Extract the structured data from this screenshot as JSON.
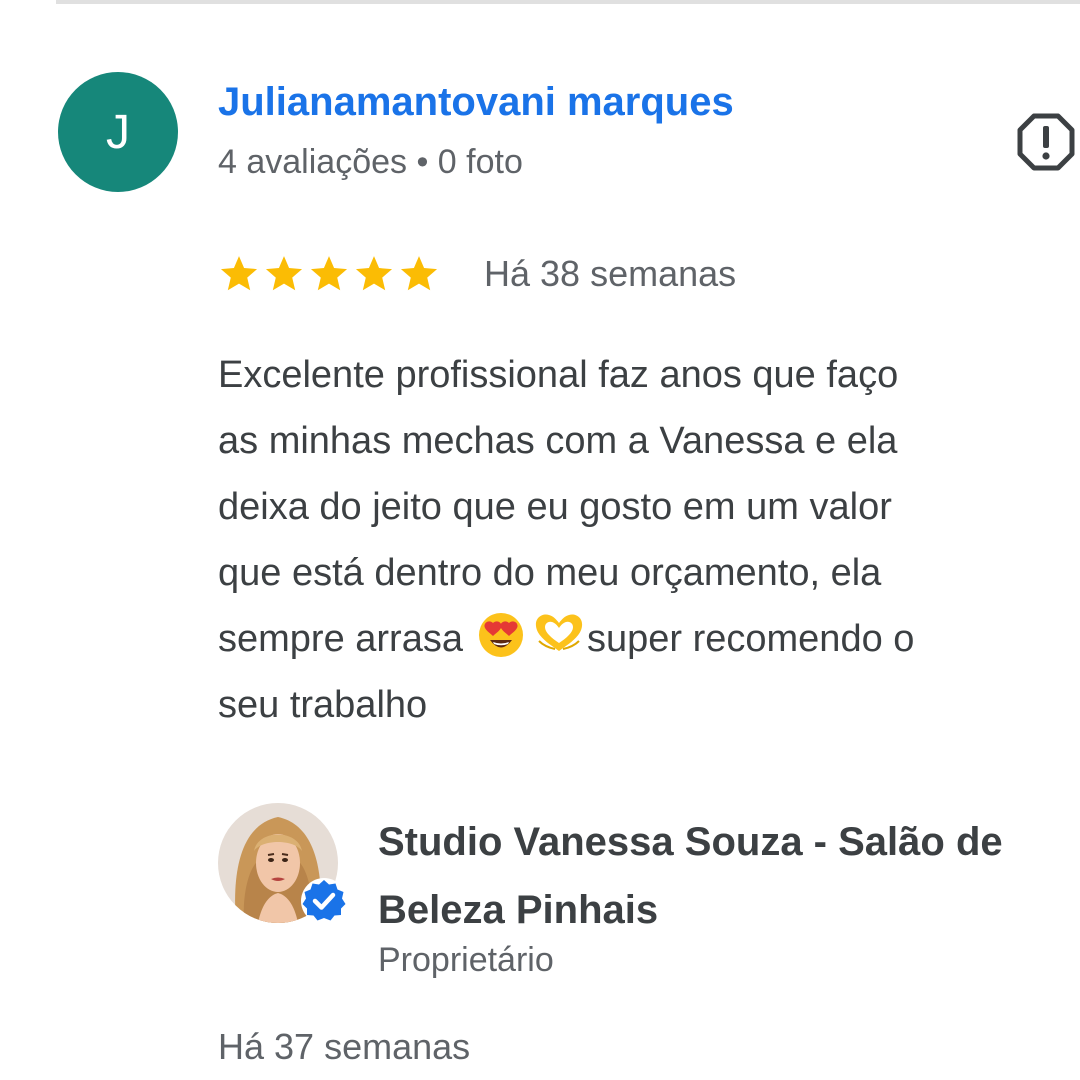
{
  "review": {
    "author": {
      "initial": "J",
      "avatar_color": "#16877a",
      "name": "Julianamantovani marques",
      "name_color": "#1a73e8",
      "meta": "4 avaliações • 0 foto"
    },
    "report_icon": "report-flag-icon",
    "rating": 5,
    "rating_max": 5,
    "star_color": "#fbbc04",
    "date": "Há 38 semanas",
    "text": {
      "line1": "Excelente profissional faz anos que faço",
      "line2": "as minhas mechas com a Vanessa e ela",
      "line3": "deixa do jeito que eu gosto em um valor",
      "line4": "que está dentro do meu orçamento, ela",
      "line5_before": "sempre arrasa",
      "line5_after": "super recomendo o",
      "line6": "seu trabalho"
    },
    "emojis": [
      "heart-eyes-emoji",
      "heart-hands-emoji"
    ]
  },
  "owner_reply": {
    "name_line1": "Studio Vanessa Souza - Salão de",
    "name_line2": "Beleza Pinhais",
    "role": "Proprietário",
    "verified_color": "#1a73e8",
    "date": "Há 37 semanas"
  }
}
